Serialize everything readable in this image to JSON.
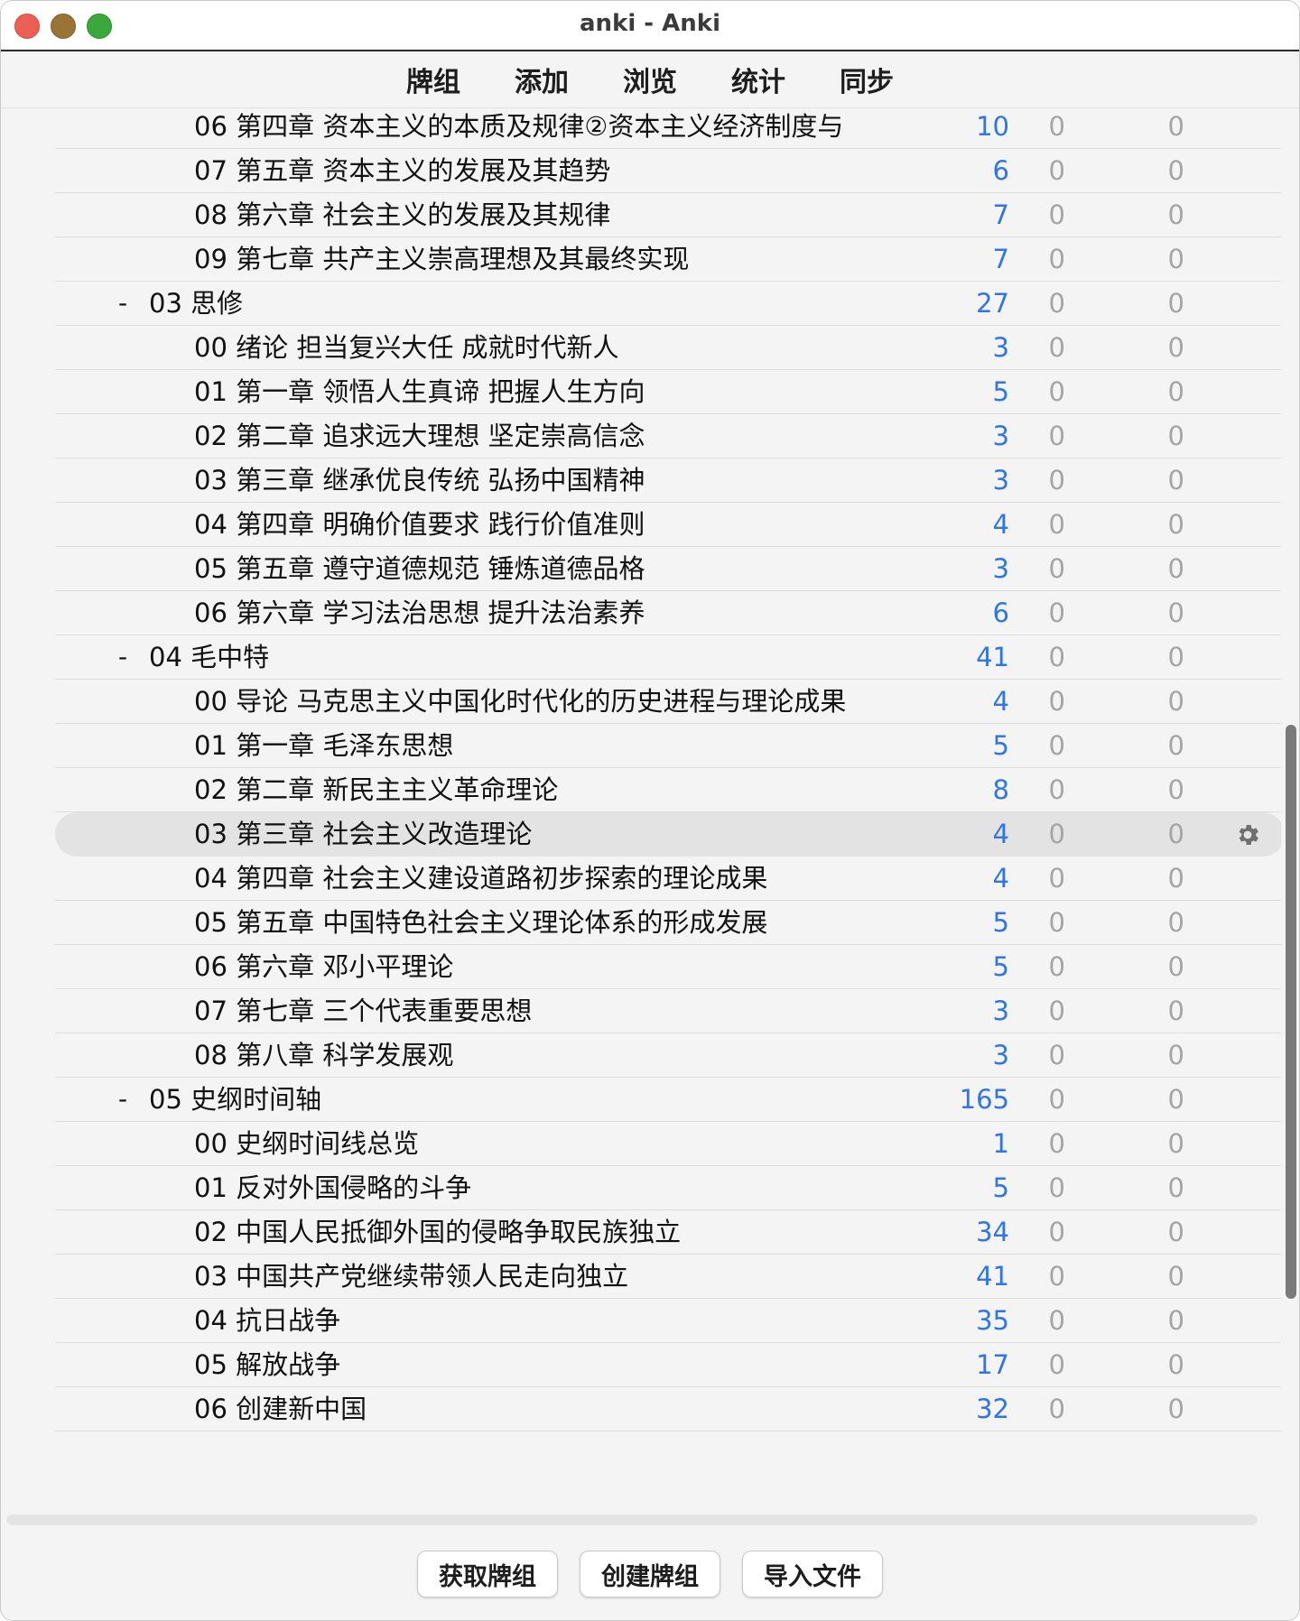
{
  "window": {
    "title": "anki - Anki"
  },
  "toolbar": [
    "牌组",
    "添加",
    "浏览",
    "统计",
    "同步"
  ],
  "decks": [
    {
      "level": 2,
      "name": "06 第四章 资本主义的本质及规律②资本主义经济制度与",
      "due": "10",
      "c2": "0",
      "c3": "0"
    },
    {
      "level": 2,
      "name": "07 第五章 资本主义的发展及其趋势",
      "due": "6",
      "c2": "0",
      "c3": "0"
    },
    {
      "level": 2,
      "name": "08 第六章 社会主义的发展及其规律",
      "due": "7",
      "c2": "0",
      "c3": "0"
    },
    {
      "level": 2,
      "name": "09 第七章 共产主义崇高理想及其最终实现",
      "due": "7",
      "c2": "0",
      "c3": "0"
    },
    {
      "level": 1,
      "toggle": "-",
      "name": "03 思修",
      "due": "27",
      "c2": "0",
      "c3": "0"
    },
    {
      "level": 2,
      "name": "00 绪论 担当复兴大任 成就时代新人",
      "due": "3",
      "c2": "0",
      "c3": "0"
    },
    {
      "level": 2,
      "name": "01 第一章 领悟人生真谛 把握人生方向",
      "due": "5",
      "c2": "0",
      "c3": "0"
    },
    {
      "level": 2,
      "name": "02 第二章 追求远大理想 坚定崇高信念",
      "due": "3",
      "c2": "0",
      "c3": "0"
    },
    {
      "level": 2,
      "name": "03 第三章 继承优良传统 弘扬中国精神",
      "due": "3",
      "c2": "0",
      "c3": "0"
    },
    {
      "level": 2,
      "name": "04 第四章 明确价值要求 践行价值准则",
      "due": "4",
      "c2": "0",
      "c3": "0"
    },
    {
      "level": 2,
      "name": "05 第五章 遵守道德规范 锤炼道德品格",
      "due": "3",
      "c2": "0",
      "c3": "0"
    },
    {
      "level": 2,
      "name": "06 第六章 学习法治思想 提升法治素养",
      "due": "6",
      "c2": "0",
      "c3": "0"
    },
    {
      "level": 1,
      "toggle": "-",
      "name": "04 毛中特",
      "due": "41",
      "c2": "0",
      "c3": "0"
    },
    {
      "level": 2,
      "name": "00 导论 马克思主义中国化时代化的历史进程与理论成果",
      "due": "4",
      "c2": "0",
      "c3": "0"
    },
    {
      "level": 2,
      "name": "01 第一章 毛泽东思想",
      "due": "5",
      "c2": "0",
      "c3": "0"
    },
    {
      "level": 2,
      "name": "02 第二章 新民主主义革命理论",
      "due": "8",
      "c2": "0",
      "c3": "0"
    },
    {
      "level": 2,
      "name": "03 第三章 社会主义改造理论",
      "due": "4",
      "c2": "0",
      "c3": "0",
      "selected": true
    },
    {
      "level": 2,
      "name": "04 第四章 社会主义建设道路初步探索的理论成果",
      "due": "4",
      "c2": "0",
      "c3": "0"
    },
    {
      "level": 2,
      "name": "05 第五章 中国特色社会主义理论体系的形成发展",
      "due": "5",
      "c2": "0",
      "c3": "0"
    },
    {
      "level": 2,
      "name": "06 第六章 邓小平理论",
      "due": "5",
      "c2": "0",
      "c3": "0"
    },
    {
      "level": 2,
      "name": "07 第七章 三个代表重要思想",
      "due": "3",
      "c2": "0",
      "c3": "0"
    },
    {
      "level": 2,
      "name": "08 第八章 科学发展观",
      "due": "3",
      "c2": "0",
      "c3": "0"
    },
    {
      "level": 1,
      "toggle": "-",
      "name": "05 史纲时间轴",
      "due": "165",
      "c2": "0",
      "c3": "0"
    },
    {
      "level": 2,
      "name": "00 史纲时间线总览",
      "due": "1",
      "c2": "0",
      "c3": "0"
    },
    {
      "level": 2,
      "name": "01 反对外国侵略的斗争",
      "due": "5",
      "c2": "0",
      "c3": "0"
    },
    {
      "level": 2,
      "name": "02 中国人民抵御外国的侵略争取民族独立",
      "due": "34",
      "c2": "0",
      "c3": "0"
    },
    {
      "level": 2,
      "name": "03 中国共产党继续带领人民走向独立",
      "due": "41",
      "c2": "0",
      "c3": "0"
    },
    {
      "level": 2,
      "name": "04 抗日战争",
      "due": "35",
      "c2": "0",
      "c3": "0"
    },
    {
      "level": 2,
      "name": "05 解放战争",
      "due": "17",
      "c2": "0",
      "c3": "0"
    },
    {
      "level": 2,
      "name": "06 创建新中国",
      "due": "32",
      "c2": "0",
      "c3": "0"
    }
  ],
  "bottom_buttons": [
    "获取牌组",
    "创建牌组",
    "导入文件"
  ],
  "icons": {
    "row_options": "gear-icon"
  },
  "colors": {
    "due": "#2f75e6",
    "zero": "#a5a5a5",
    "selected_row": "#e3e3e3"
  }
}
